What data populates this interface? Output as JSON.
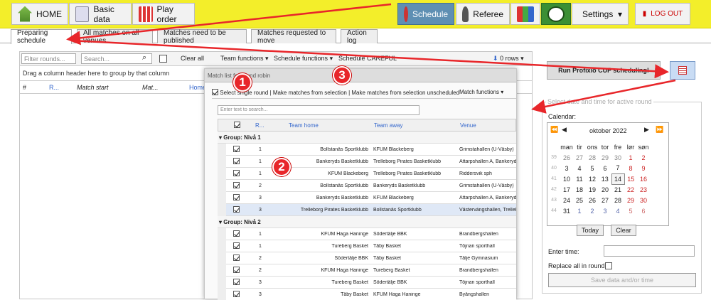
{
  "topbar": {
    "home": "HOME",
    "basic_data": "Basic data",
    "play_order": "Play order",
    "schedule": "Schedule",
    "referee": "Referee",
    "settings": "Settings",
    "logout": "LOG OUT"
  },
  "tabs": [
    "Preparing schedule",
    "All matches on all venues",
    "Matches need to be published",
    "Matches requested to move",
    "Action log"
  ],
  "left": {
    "filter_placeholder": "Filter rounds...",
    "search_placeholder": "Search...",
    "clear_all": "Clear all",
    "team_functions": "Team functions",
    "schedule_functions": "Schedule functions",
    "schedule_careful": "Schedule CAREFUL",
    "rows": "0 rows",
    "group_hint": "Drag a column header here to group by that column",
    "cols": [
      "#",
      "R...",
      "Match start",
      "Mat...",
      "Home"
    ]
  },
  "popup": {
    "title": "Match list for round robin",
    "select_single": "Select single round",
    "make_from_sel": "Make matches from selection",
    "make_unsched": "Make matches from selection unscheduled",
    "match_functions": "Match functions",
    "filter_placeholder": "Enter text to search...",
    "headers": {
      "r": "R...",
      "home": "Team home",
      "away": "Team away",
      "venue": "Venue"
    },
    "groups": [
      {
        "name": "Group: Nivå 1",
        "rows": [
          {
            "r": "1",
            "home": "Bollstanäs Sportklubb",
            "away": "KFUM Blackeberg",
            "venue": "Grimstahallen (U-Väsby)"
          },
          {
            "r": "1",
            "home": "Bankeryds Basketklubb",
            "away": "Trelleborg Pirates Basketklubb",
            "venue": "Attarpshallen A, Bankeryd"
          },
          {
            "r": "1",
            "home": "KFUM Blackeberg",
            "away": "Trelleborg Pirates Basketklubb",
            "venue": "Riddersvik sph"
          },
          {
            "r": "2",
            "home": "Bollstanäs Sportklubb",
            "away": "Bankeryds Basketklubb",
            "venue": "Grimstahallen (U-Väsby)"
          },
          {
            "r": "3",
            "home": "Bankeryds Basketklubb",
            "away": "KFUM Blackeberg",
            "venue": "Attarpshallen A, Bankeryd"
          },
          {
            "r": "3",
            "home": "Trelleborg Pirates Basketklubb",
            "away": "Bollstanäs Sportklubb",
            "venue": "Västervångshallen, Trelleb..."
          }
        ]
      },
      {
        "name": "Group: Nivå 2",
        "rows": [
          {
            "r": "1",
            "home": "KFUM Haga Haninge",
            "away": "Södertälje BBK",
            "venue": "Brandbergshallen"
          },
          {
            "r": "1",
            "home": "Tureberg Basket",
            "away": "Täby Basket",
            "venue": "Töjnan sporthall"
          },
          {
            "r": "2",
            "home": "Södertälje BBK",
            "away": "Täby Basket",
            "venue": "Tälje Gymnasium"
          },
          {
            "r": "2",
            "home": "KFUM Haga Haninge",
            "away": "Tureberg Basket",
            "venue": "Brandbergshallen"
          },
          {
            "r": "3",
            "home": "Tureberg Basket",
            "away": "Södertälje BBK",
            "venue": "Töjnan sporthall"
          },
          {
            "r": "3",
            "home": "Täby Basket",
            "away": "KFUM Haga Haninge",
            "venue": "Byängshallen"
          }
        ]
      }
    ],
    "badges": [
      "1",
      "2",
      "3"
    ]
  },
  "right": {
    "run_cup": "Run Profixio CUP scheduling!",
    "fieldset": "Select date and time for active round",
    "calendar_label": "Calendar:",
    "month": "oktober 2022",
    "days": [
      "man",
      "tir",
      "ons",
      "tor",
      "fre",
      "lør",
      "søn"
    ],
    "weeks": [
      {
        "wk": "39",
        "d": [
          "26",
          "27",
          "28",
          "29",
          "30",
          "1",
          "2"
        ]
      },
      {
        "wk": "40",
        "d": [
          "3",
          "4",
          "5",
          "6",
          "7",
          "8",
          "9"
        ]
      },
      {
        "wk": "41",
        "d": [
          "10",
          "11",
          "12",
          "13",
          "14",
          "15",
          "16"
        ]
      },
      {
        "wk": "42",
        "d": [
          "17",
          "18",
          "19",
          "20",
          "21",
          "22",
          "23"
        ]
      },
      {
        "wk": "43",
        "d": [
          "24",
          "25",
          "26",
          "27",
          "28",
          "29",
          "30"
        ]
      },
      {
        "wk": "44",
        "d": [
          "31",
          "1",
          "2",
          "3",
          "4",
          "5",
          "6"
        ]
      }
    ],
    "today": "Today",
    "clear": "Clear",
    "enter_time": "Enter time:",
    "replace_all": "Replace all in round:",
    "save": "Save data and/or time"
  },
  "colors": {
    "accent_red": "#e8262a",
    "topbar": "#f3ee2a",
    "schedule_blue": "#5e8fb3"
  }
}
